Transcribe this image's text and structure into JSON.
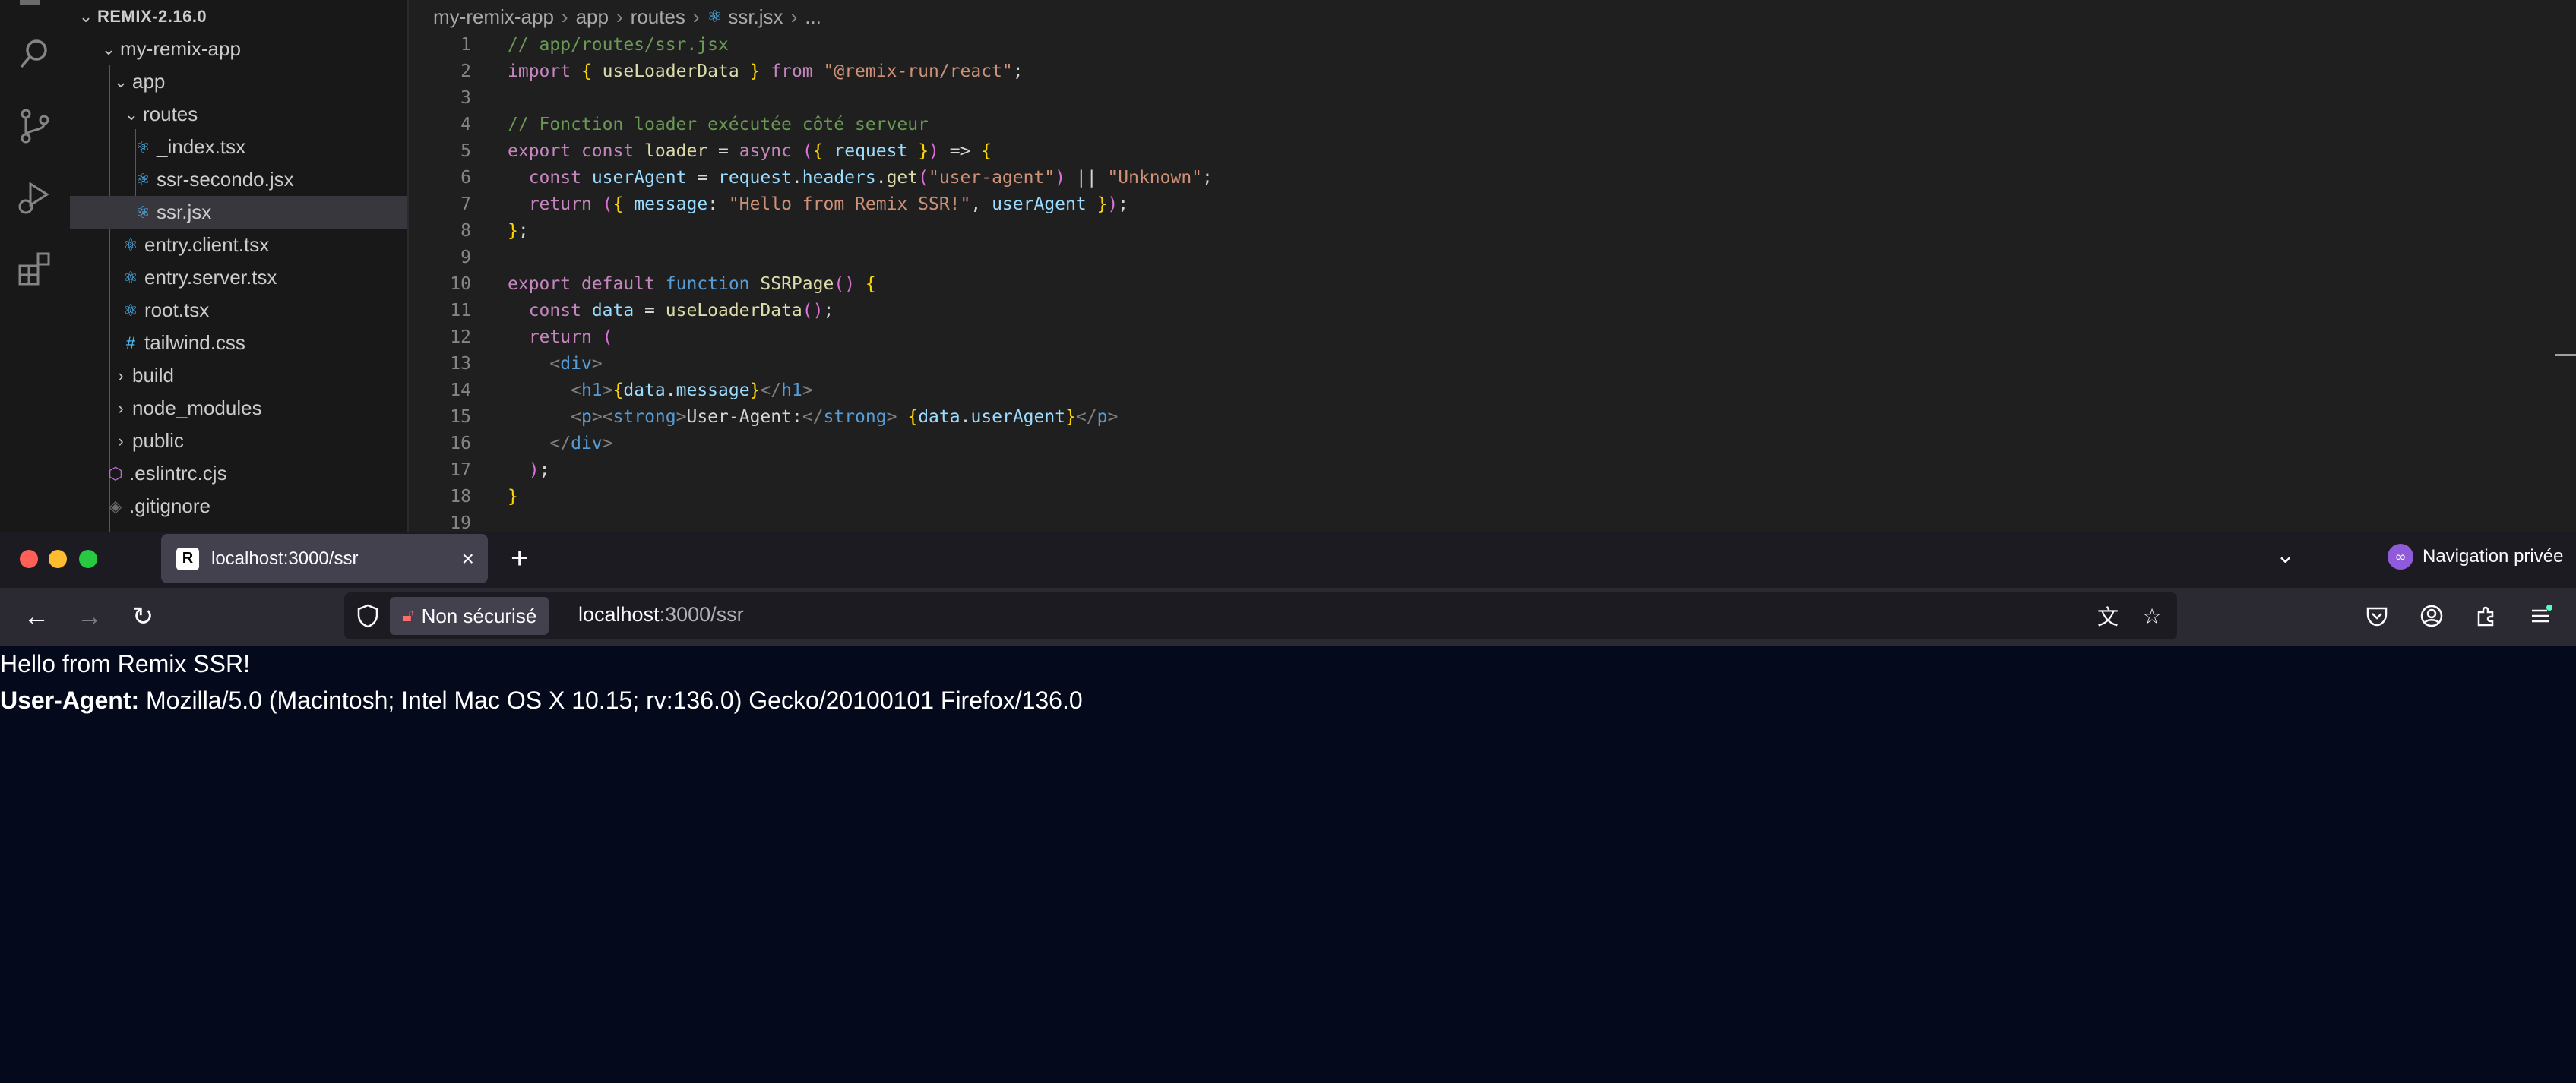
{
  "explorer": {
    "root": "REMIX-2.16.0",
    "items": [
      {
        "label": "my-remix-app",
        "icon": "chevron-down-icon"
      },
      {
        "label": "app",
        "icon": "chevron-down-icon"
      },
      {
        "label": "routes",
        "icon": "chevron-down-icon"
      },
      {
        "label": "_index.tsx",
        "icon": "react-icon"
      },
      {
        "label": "ssr-secondo.jsx",
        "icon": "react-icon"
      },
      {
        "label": "ssr.jsx",
        "icon": "react-icon",
        "selected": true
      },
      {
        "label": "entry.client.tsx",
        "icon": "react-icon"
      },
      {
        "label": "entry.server.tsx",
        "icon": "react-icon"
      },
      {
        "label": "root.tsx",
        "icon": "react-icon"
      },
      {
        "label": "tailwind.css",
        "icon": "hash-icon"
      },
      {
        "label": "build",
        "icon": "chevron-right-icon"
      },
      {
        "label": "node_modules",
        "icon": "chevron-right-icon"
      },
      {
        "label": "public",
        "icon": "chevron-right-icon"
      },
      {
        "label": ".eslintrc.cjs",
        "icon": "eslint-icon"
      },
      {
        "label": ".gitignore",
        "icon": "git-icon"
      }
    ]
  },
  "breadcrumbs": [
    "my-remix-app",
    "app",
    "routes",
    "ssr.jsx",
    "..."
  ],
  "editor": {
    "line_numbers": [
      "1",
      "2",
      "3",
      "4",
      "5",
      "6",
      "7",
      "8",
      "9",
      "10",
      "11",
      "12",
      "13",
      "14",
      "15",
      "16",
      "17",
      "18",
      "19"
    ],
    "lines": [
      "// app/routes/ssr.jsx",
      "import { useLoaderData } from \"@remix-run/react\";",
      "",
      "// Fonction loader exécutée côté serveur",
      "export const loader = async ({ request }) => {",
      "  const userAgent = request.headers.get(\"user-agent\") || \"Unknown\";",
      "  return ({ message: \"Hello from Remix SSR!\", userAgent });",
      "};",
      "",
      "export default function SSRPage() {",
      "  const data = useLoaderData();",
      "  return (",
      "    <div>",
      "      <h1>{data.message}</h1>",
      "      <p><strong>User-Agent:</strong> {data.userAgent}</p>",
      "    </div>",
      "  );",
      "}",
      ""
    ]
  },
  "browser": {
    "tab_title": "localhost:3000/ssr",
    "tab_favicon": "R",
    "new_tab": "+",
    "private_label": "Navigation privée",
    "insecure_label": "Non sécurisé",
    "url_host": "localhost",
    "url_path": ":3000/ssr"
  },
  "page": {
    "heading": "Hello from Remix SSR!",
    "ua_label": "User-Agent:",
    "ua_value": " Mozilla/5.0 (Macintosh; Intel Mac OS X 10.15; rv:136.0) Gecko/20100101 Firefox/136.0"
  },
  "colors": {
    "editor_bg": "#1f1f1f",
    "sidebar_bg": "#181818",
    "browser_bg": "#040a1c",
    "accent": "#4fc1ff"
  }
}
